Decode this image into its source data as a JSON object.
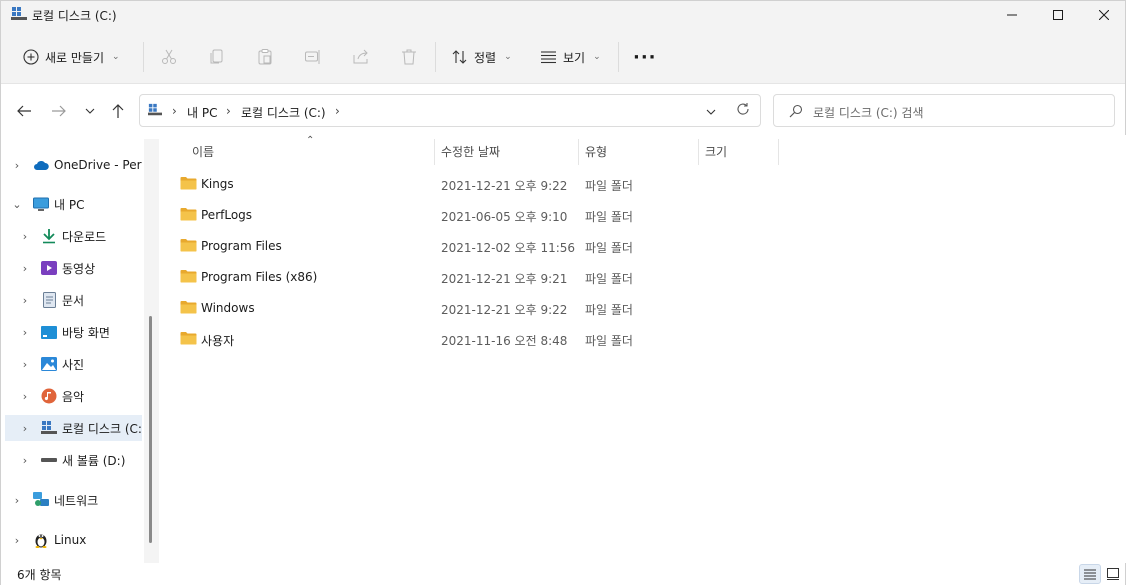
{
  "window": {
    "title": "로컬 디스크 (C:)"
  },
  "toolbar": {
    "new_label": "새로 만들기",
    "sort_label": "정렬",
    "view_label": "보기",
    "more_label": "···"
  },
  "address": {
    "crumbs": [
      "내 PC",
      "로컬 디스크 (C:)"
    ]
  },
  "search": {
    "placeholder": "로컬 디스크 (C:) 검색"
  },
  "sidebar": {
    "items": [
      {
        "label": "OneDrive - Personal"
      },
      {
        "label": "내 PC"
      },
      {
        "label": "다운로드"
      },
      {
        "label": "동영상"
      },
      {
        "label": "문서"
      },
      {
        "label": "바탕 화면"
      },
      {
        "label": "사진"
      },
      {
        "label": "음악"
      },
      {
        "label": "로컬 디스크 (C:)"
      },
      {
        "label": "새 볼륨 (D:)"
      },
      {
        "label": "네트워크"
      },
      {
        "label": "Linux"
      }
    ]
  },
  "columns": {
    "name": "이름",
    "date": "수정한 날짜",
    "type": "유형",
    "size": "크기"
  },
  "files": [
    {
      "name": "Kings",
      "date": "2021-12-21 오후 9:22",
      "type": "파일 폴더"
    },
    {
      "name": "PerfLogs",
      "date": "2021-06-05 오후 9:10",
      "type": "파일 폴더"
    },
    {
      "name": "Program Files",
      "date": "2021-12-02 오후 11:56",
      "type": "파일 폴더"
    },
    {
      "name": "Program Files (x86)",
      "date": "2021-12-21 오후 9:21",
      "type": "파일 폴더"
    },
    {
      "name": "Windows",
      "date": "2021-12-21 오후 9:22",
      "type": "파일 폴더"
    },
    {
      "name": "사용자",
      "date": "2021-11-16 오전 8:48",
      "type": "파일 폴더"
    }
  ],
  "status": {
    "item_count": "6개 항목"
  },
  "colors": {
    "folder": "#f4c34a",
    "accent": "#0067c0",
    "selected": "#e6eef7"
  }
}
